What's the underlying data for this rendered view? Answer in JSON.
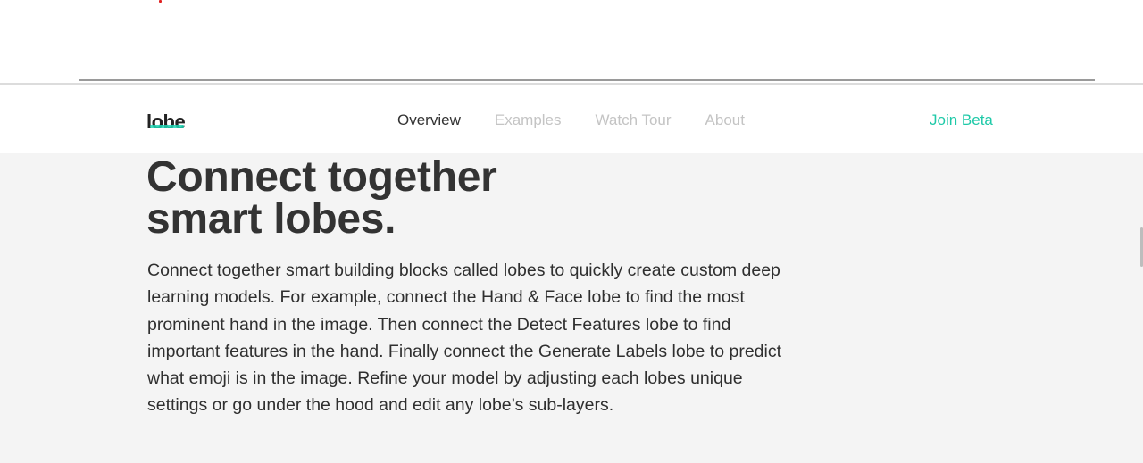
{
  "nav": {
    "logo": "lobe",
    "links": [
      "Overview",
      "Examples",
      "Watch Tour",
      "About"
    ],
    "active_link": "Overview",
    "cta": "Join Beta"
  },
  "hero": {
    "headline_line1": "Connect together",
    "headline_line2": "smart lobes.",
    "paragraph": "Connect together smart building blocks called lobes to quickly create custom deep learning models. For example, connect the Hand & Face lobe to find the most prominent hand in the image. Then connect the Detect Features lobe to find important features in the hand. Finally connect the Generate Labels lobe to predict what emoji is in the image. Refine your model by adjusting each lobes unique settings or go under the hood and edit any lobe’s sub-layers."
  },
  "colors": {
    "accent": "#1fc9a8",
    "text_dark": "#333333",
    "text_muted": "#c4c4c4",
    "section_bg": "#f4f4f4"
  }
}
